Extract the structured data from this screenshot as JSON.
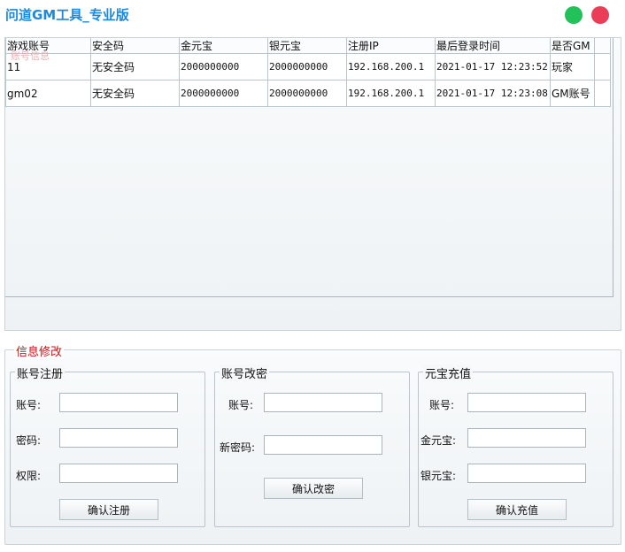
{
  "app": {
    "title": "问道GM工具_专业版"
  },
  "account_panel": {
    "legend": "账号信息",
    "columns": [
      "游戏账号",
      "安全码",
      "金元宝",
      "银元宝",
      "注册IP",
      "最后登录时间",
      "是否GM"
    ],
    "rows": [
      [
        "11",
        "无安全码",
        "2000000000",
        "2000000000",
        "192.168.200.1",
        "2021-01-17 12:23:52",
        "玩家"
      ],
      [
        "gm02",
        "无安全码",
        "2000000000",
        "2000000000",
        "192.168.200.1",
        "2021-01-17 12:23:08",
        "GM账号"
      ]
    ]
  },
  "modify": {
    "legend": "信息修改",
    "register": {
      "legend": "账号注册",
      "account_label": "账号:",
      "password_label": "密码:",
      "permission_label": "权限:",
      "account_value": "",
      "password_value": "",
      "permission_value": "",
      "submit": "确认注册"
    },
    "change_password": {
      "legend": "账号改密",
      "account_label": "账号:",
      "new_password_label": "新密码:",
      "account_value": "",
      "new_password_value": "",
      "submit": "确认改密"
    },
    "recharge": {
      "legend": "元宝充值",
      "account_label": "账号:",
      "gold_label": "金元宝:",
      "silver_label": "银元宝:",
      "account_value": "",
      "gold_value": "",
      "silver_value": "",
      "submit": "确认充值"
    }
  }
}
